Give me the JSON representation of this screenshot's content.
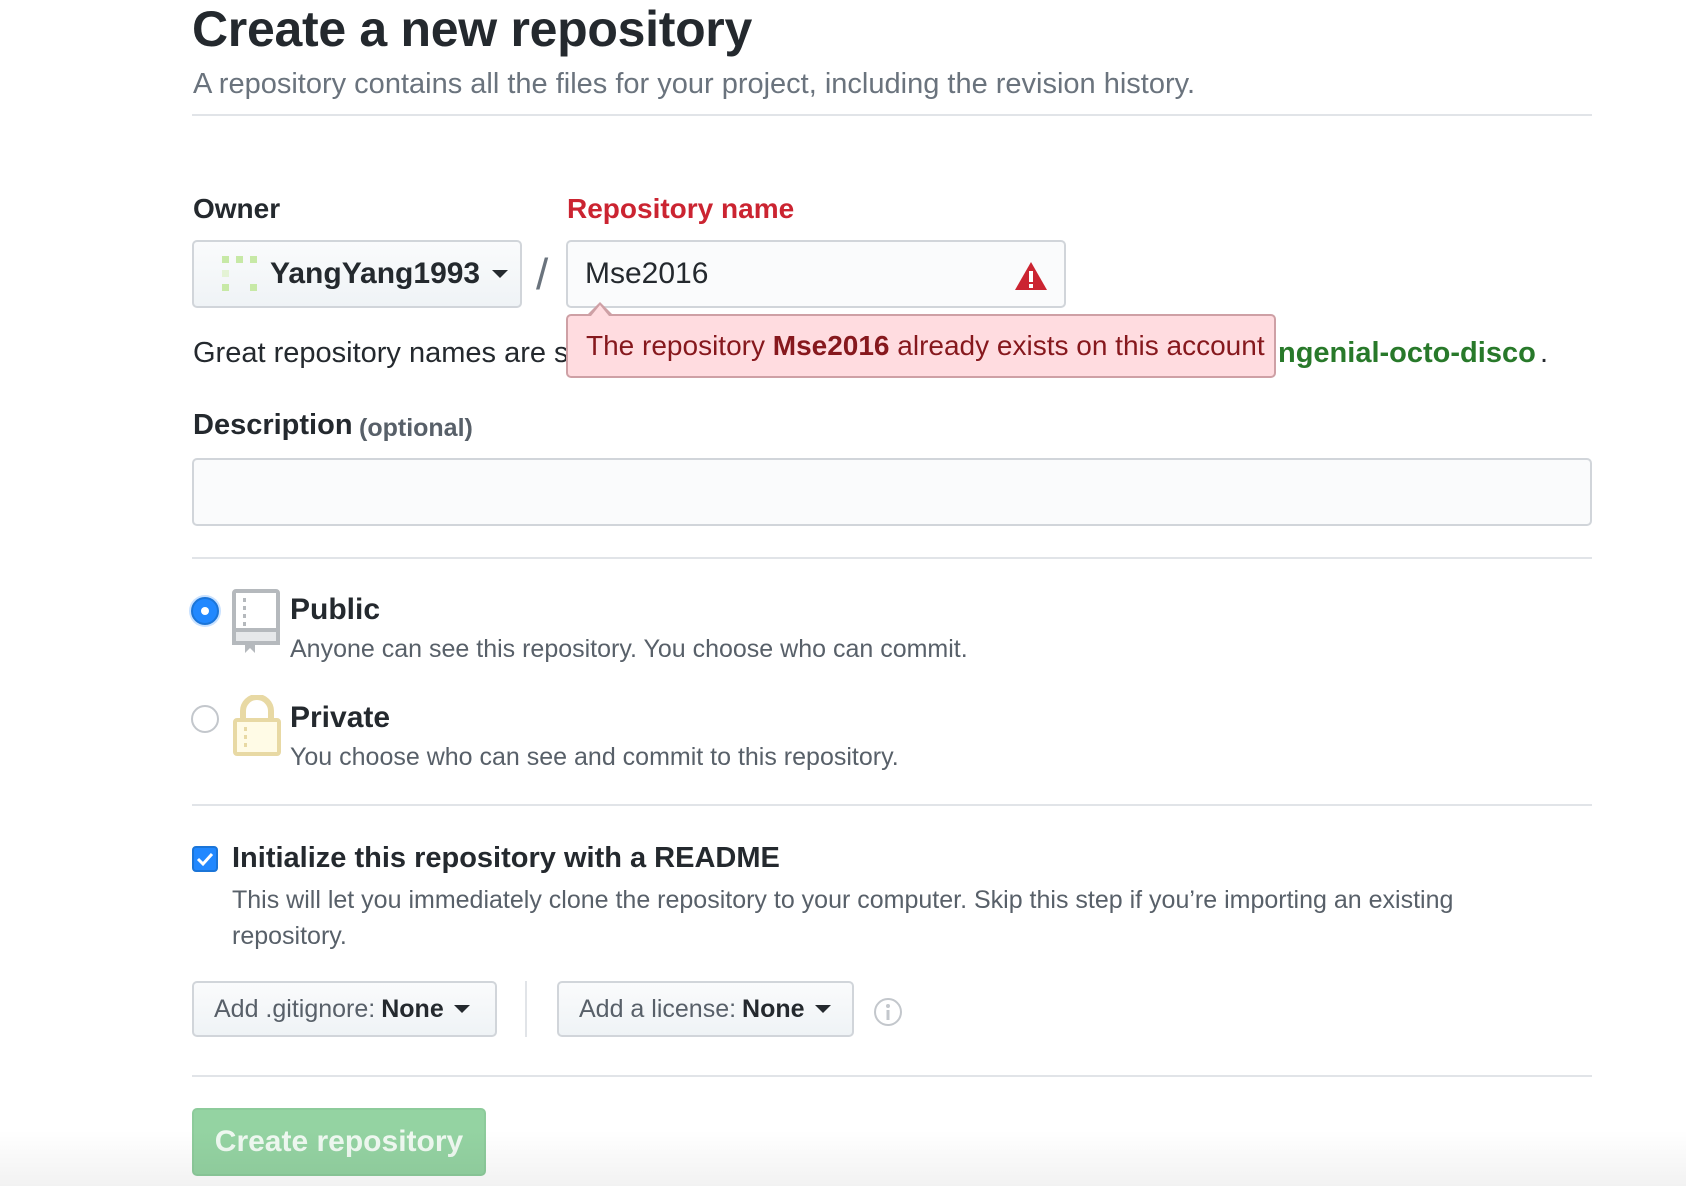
{
  "header": {
    "title": "Create a new repository",
    "subtitle": "A repository contains all the files for your project, including the revision history."
  },
  "owner": {
    "label": "Owner",
    "value": "YangYang1993"
  },
  "separator": "/",
  "repo_name": {
    "label": "Repository name",
    "value": "Mse2016",
    "error": {
      "prefix": "The repository ",
      "name": "Mse2016",
      "suffix": " already exists on this account"
    }
  },
  "helper": {
    "text_visible": "Great repository names are s",
    "suggestion_visible": "ngenial-octo-disco",
    "end": "."
  },
  "description": {
    "label": "Description",
    "optional": "(optional)",
    "value": ""
  },
  "visibility": {
    "selected": "public",
    "public": {
      "title": "Public",
      "desc": "Anyone can see this repository. You choose who can commit."
    },
    "private": {
      "title": "Private",
      "desc": "You choose who can see and commit to this repository."
    }
  },
  "readme": {
    "checked": true,
    "title": "Initialize this repository with a README",
    "desc": "This will let you immediately clone the repository to your computer. Skip this step if you’re importing an existing repository."
  },
  "gitignore": {
    "label": "Add .gitignore:",
    "value": "None"
  },
  "license": {
    "label": "Add a license:",
    "value": "None"
  },
  "submit": {
    "label": "Create repository",
    "enabled": false
  },
  "colors": {
    "error_text": "#cb2431",
    "error_bg": "#ffdce0",
    "suggestion_green": "#28792a",
    "primary_blue": "#2188ff",
    "button_green_disabled": "#94d3a2"
  },
  "icons": [
    "caret-down-icon",
    "warning-icon",
    "repo-book-icon",
    "lock-icon",
    "info-icon",
    "checkmark-icon"
  ]
}
